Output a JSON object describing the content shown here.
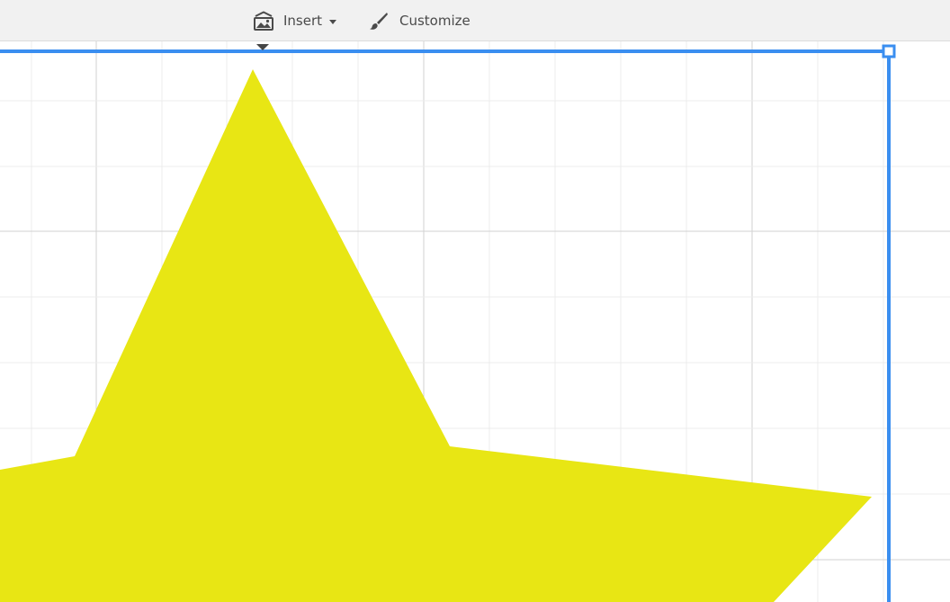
{
  "toolbar": {
    "insert": {
      "label": "Insert",
      "icon": "insert-image-icon"
    },
    "customize": {
      "label": "Customize",
      "icon": "paintbrush-icon"
    }
  },
  "canvas": {
    "grid": true,
    "shape": {
      "type": "star",
      "fill": "#e8e614"
    },
    "selection": {
      "color": "#3a8ef0"
    }
  },
  "colors": {
    "toolbar_bg": "#f1f1f1",
    "text": "#4a4a4a",
    "grid_minor": "#ececec",
    "grid_major": "#d2d2d2"
  }
}
